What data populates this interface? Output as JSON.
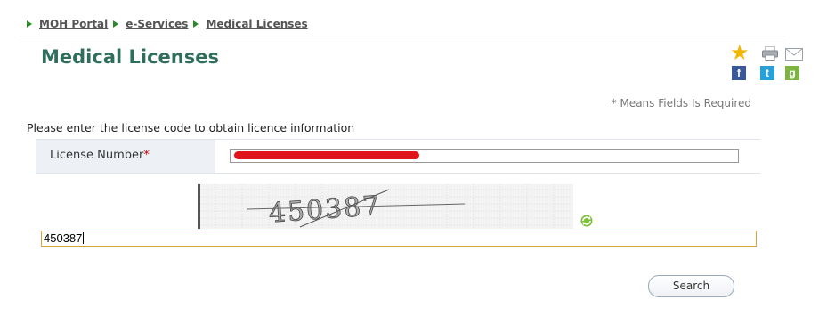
{
  "breadcrumb": {
    "items": [
      {
        "label": "MOH Portal"
      },
      {
        "label": "e-Services"
      },
      {
        "label": "Medical Licenses"
      }
    ]
  },
  "page": {
    "title": "Medical Licenses",
    "required_note": "* Means Fields Is Required",
    "instruction": "Please enter the license code to obtain licence information"
  },
  "form": {
    "license_label": "License Number",
    "required_marker": "*",
    "captcha_text": "450387",
    "captcha_value": "450387",
    "search_label": "Search"
  },
  "icons": {
    "favorite": "star-icon",
    "print": "printer-icon",
    "email": "mail-icon",
    "facebook": "facebook-icon",
    "twitter": "twitter-icon",
    "google_plus": "google-plus-icon",
    "refresh": "refresh-icon"
  },
  "colors": {
    "title": "#2f6e5c",
    "breadcrumb_arrow": "#2a8a2a",
    "required": "#cc0000",
    "captcha_focus_border": "#d8a13a",
    "redaction": "#e0141b"
  }
}
